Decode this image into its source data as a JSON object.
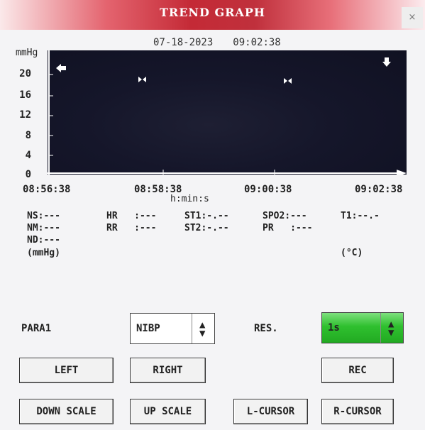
{
  "title": "TREND GRAPH",
  "close_label": "×",
  "datetime": {
    "date": "07-18-2023",
    "time": "09:02:38"
  },
  "graph": {
    "y_unit": "mmHg",
    "y_ticks": [
      "20",
      "16",
      "12",
      "8",
      "4",
      "0"
    ],
    "x_ticks": [
      "08:56:38",
      "08:58:38",
      "09:00:38",
      "09:02:38"
    ],
    "x_unit": "h:min:s",
    "background_color": "#15162a",
    "axis_color": "#ffffff"
  },
  "params": {
    "ns": "NS:---",
    "nm": "NM:---",
    "nd": "ND:---",
    "bp_unit": "(mmHg)",
    "hr": "HR   :---",
    "rr": "RR   :---",
    "st1": "ST1:-.--",
    "st2": "ST2:-.--",
    "spo2": "SPO2:---",
    "pr": "PR   :---",
    "t1": "T1:--.-",
    "temp_unit": "(°C)"
  },
  "controls": {
    "para1_label": "PARA1",
    "para1_value": "NIBP",
    "res_label": "RES.",
    "res_value": "1s",
    "res_color": "#22bb22",
    "left": "LEFT",
    "right": "RIGHT",
    "rec": "REC",
    "down_scale": "DOWN SCALE",
    "up_scale": "UP SCALE",
    "l_cursor": "L-CURSOR",
    "r_cursor": "R-CURSOR"
  }
}
